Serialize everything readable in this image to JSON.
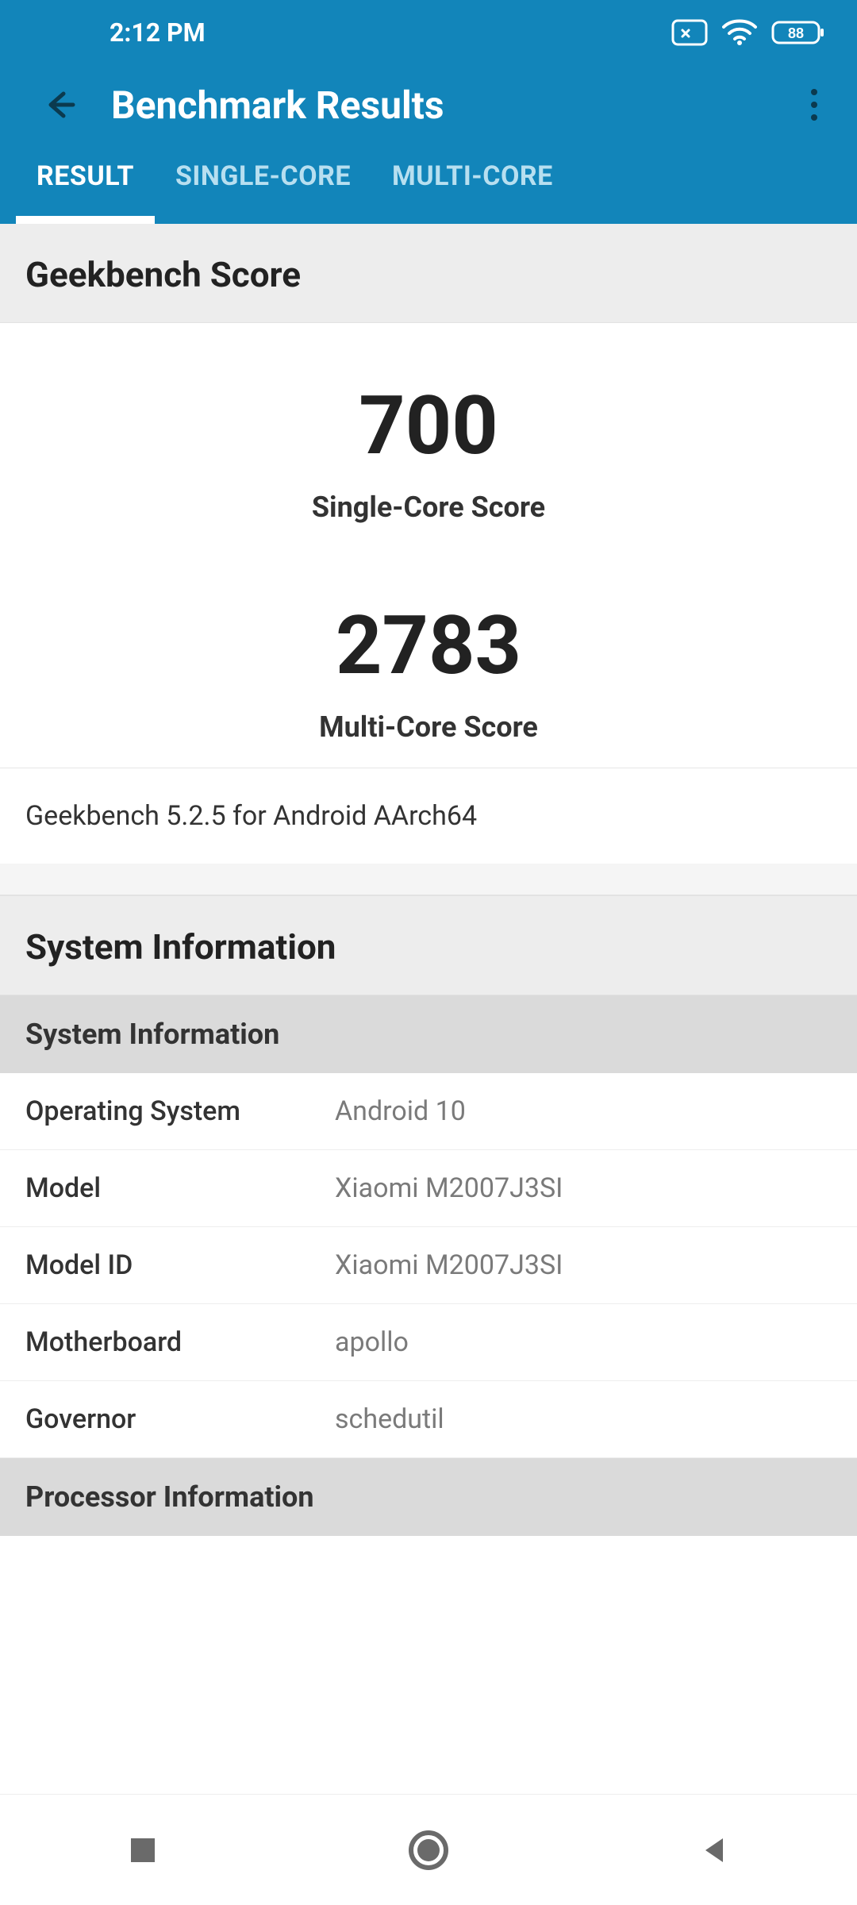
{
  "status": {
    "time": "2:12 PM",
    "battery": "88"
  },
  "appbar": {
    "title": "Benchmark Results"
  },
  "tabs": [
    {
      "label": "RESULT",
      "active": true
    },
    {
      "label": "SINGLE-CORE",
      "active": false
    },
    {
      "label": "MULTI-CORE",
      "active": false
    }
  ],
  "score_section": {
    "title": "Geekbench Score",
    "single": {
      "value": "700",
      "label": "Single-Core Score"
    },
    "multi": {
      "value": "2783",
      "label": "Multi-Core Score"
    },
    "version": "Geekbench 5.2.5 for Android AArch64"
  },
  "sysinfo_section": {
    "title": "System Information",
    "subheader": "System Information",
    "rows": [
      {
        "k": "Operating System",
        "v": "Android 10"
      },
      {
        "k": "Model",
        "v": "Xiaomi M2007J3SI"
      },
      {
        "k": "Model ID",
        "v": "Xiaomi M2007J3SI"
      },
      {
        "k": "Motherboard",
        "v": "apollo"
      },
      {
        "k": "Governor",
        "v": "schedutil"
      }
    ],
    "proc_subheader": "Processor Information"
  }
}
